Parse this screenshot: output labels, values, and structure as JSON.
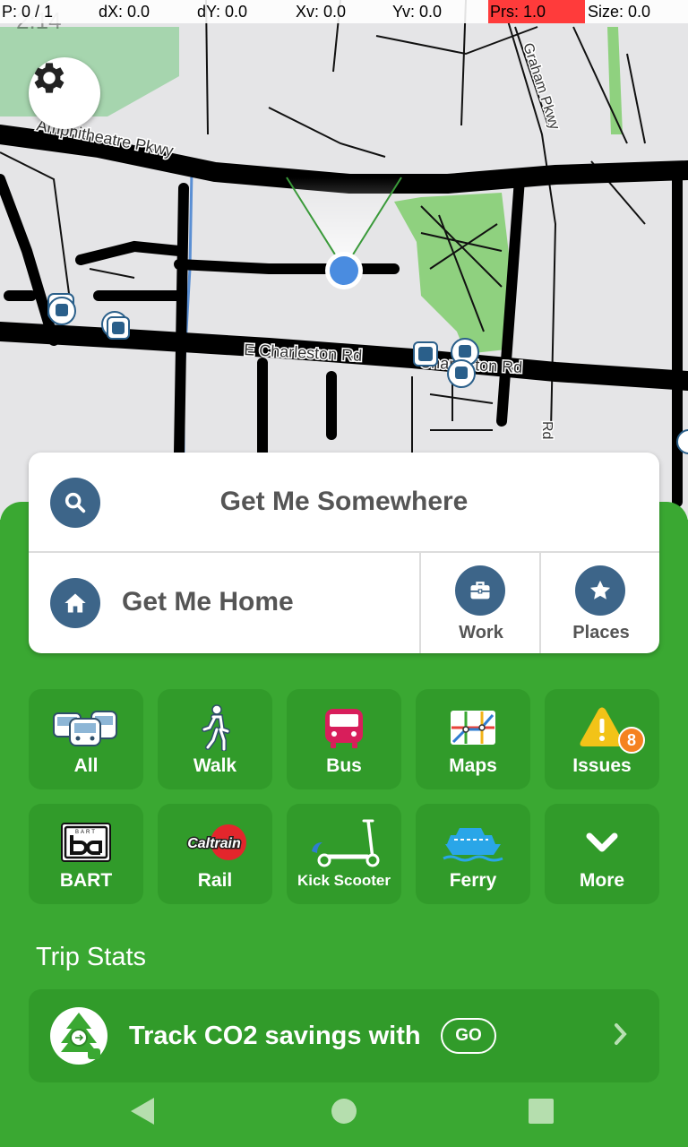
{
  "debug": {
    "pointer": "P: 0 / 1",
    "dx": "dX: 0.0",
    "dy": "dY: 0.0",
    "xv": "Xv: 0.0",
    "yv": "Yv: 0.0",
    "prs": "Prs: 1.0",
    "size": "Size: 0.0"
  },
  "status": {
    "time": "2:14"
  },
  "map": {
    "roads": {
      "amphitheatre": "Amphitheatre Pkwy",
      "charleston": "E Charleston Rd",
      "charleston2": "Charleston Rd",
      "graham": "Graham Pkwy",
      "rd": "Rd"
    },
    "settings_icon": "gear-icon"
  },
  "search": {
    "main_label": "Get Me Somewhere",
    "home_label": "Get Me Home",
    "work_label": "Work",
    "places_label": "Places"
  },
  "modes": [
    {
      "label": "All",
      "icon": "all-transit-icon"
    },
    {
      "label": "Walk",
      "icon": "walk-icon"
    },
    {
      "label": "Bus",
      "icon": "bus-icon"
    },
    {
      "label": "Maps",
      "icon": "maps-icon"
    },
    {
      "label": "Issues",
      "icon": "warning-icon",
      "badge": "8"
    },
    {
      "label": "BART",
      "icon": "bart-icon",
      "logo_text": "BART"
    },
    {
      "label": "Rail",
      "icon": "caltrain-icon",
      "logo_text": "Caltrain"
    },
    {
      "label": "Kick Scooter",
      "icon": "scooter-icon"
    },
    {
      "label": "Ferry",
      "icon": "ferry-icon"
    },
    {
      "label": "More",
      "icon": "chevron-down-icon"
    }
  ],
  "trip_stats": {
    "title": "Trip Stats",
    "card_text": "Track CO2 savings with",
    "go_label": "GO"
  },
  "colors": {
    "brand_green": "#3aa832",
    "tile_green": "#319b2a",
    "icon_blue": "#3d6589",
    "badge_orange": "#f58220"
  }
}
